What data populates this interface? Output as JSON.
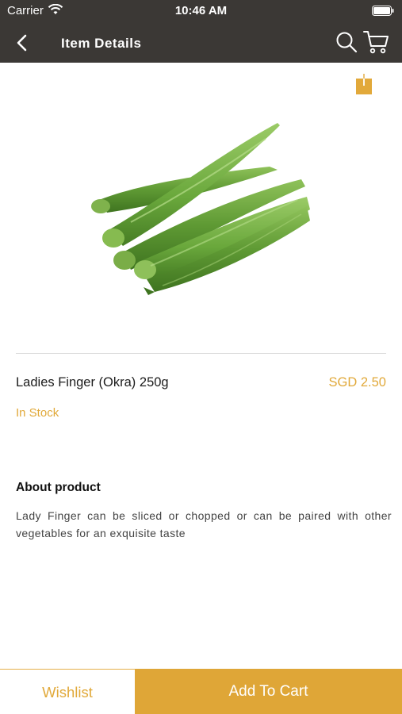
{
  "status_bar": {
    "carrier": "Carrier",
    "time": "10:46 AM"
  },
  "nav": {
    "title": "Item Details",
    "icons": [
      "back-icon",
      "search-icon",
      "cart-icon"
    ]
  },
  "product": {
    "image": "okra-photo",
    "name": "Ladies Finger (Okra) 250g",
    "price": "SGD 2.50",
    "stock": "In Stock"
  },
  "about": {
    "heading": "About product",
    "text": "Lady Finger can be sliced or chopped or can be paired with other vegetables for an exquisite taste"
  },
  "actions": {
    "wishlist_label": "Wishlist",
    "add_to_cart_label": "Add To Cart"
  },
  "colors": {
    "accent": "#dfa637",
    "header_bg": "#3b3835"
  }
}
